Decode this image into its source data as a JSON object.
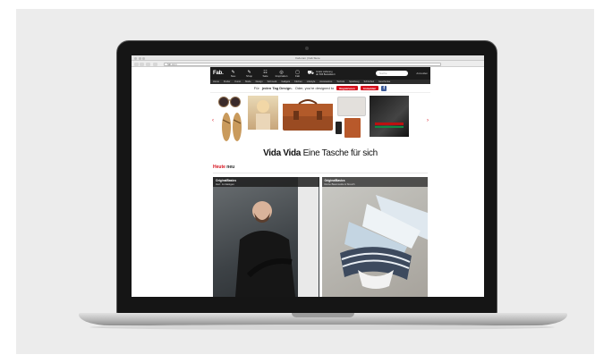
{
  "browser": {
    "window_title": "Fab.com | Fab Store",
    "url": "fab.com"
  },
  "site": {
    "logo": "Fab.",
    "nav_icons": [
      {
        "glyph": "✎",
        "label": "Neu"
      },
      {
        "glyph": "✎",
        "label": "Shop"
      },
      {
        "glyph": "☷",
        "label": "Sale"
      },
      {
        "glyph": "◎",
        "label": "Inspiration"
      },
      {
        "glyph": "▢",
        "label": "Fab"
      }
    ],
    "shipping_line1": "Gratis Lieferung",
    "shipping_line2": "ab 50€ Bestellwert",
    "search_placeholder": "Suche",
    "account_label": "Anmelden",
    "categories": [
      "Home",
      "Kinder",
      "Kunst",
      "Mode",
      "Design",
      "Schmuck",
      "Gadgets",
      "Kitchen",
      "Lifestyle",
      "Accessoires",
      "Technik",
      "Spielzeug",
      "Schönheit",
      "Geschenke"
    ],
    "promo": {
      "text_pre": "Für",
      "text_bold": "jeden Tag Design.",
      "text_post": "Oder, you're designed to",
      "register_label": "Registrieren",
      "login_label": "Anmelden",
      "facebook_label": "f"
    },
    "hero": {
      "title_bold": "Vida Vida",
      "title_rest": "Eine Tasche für sich",
      "prev_arrow": "‹",
      "next_arrow": "›"
    },
    "section": {
      "title_red": "Heute",
      "title_rest": "neu"
    },
    "tiles": [
      {
        "title": "OriginalBasics",
        "subtitle": "Herr. zu lässigen"
      },
      {
        "title": "OriginalBasics",
        "subtitle": "Reine Baumwolle & Stretch"
      }
    ]
  },
  "colors": {
    "accent_red": "#d6101c",
    "topbar": "#1b1b1b",
    "bezel": "#151515"
  }
}
